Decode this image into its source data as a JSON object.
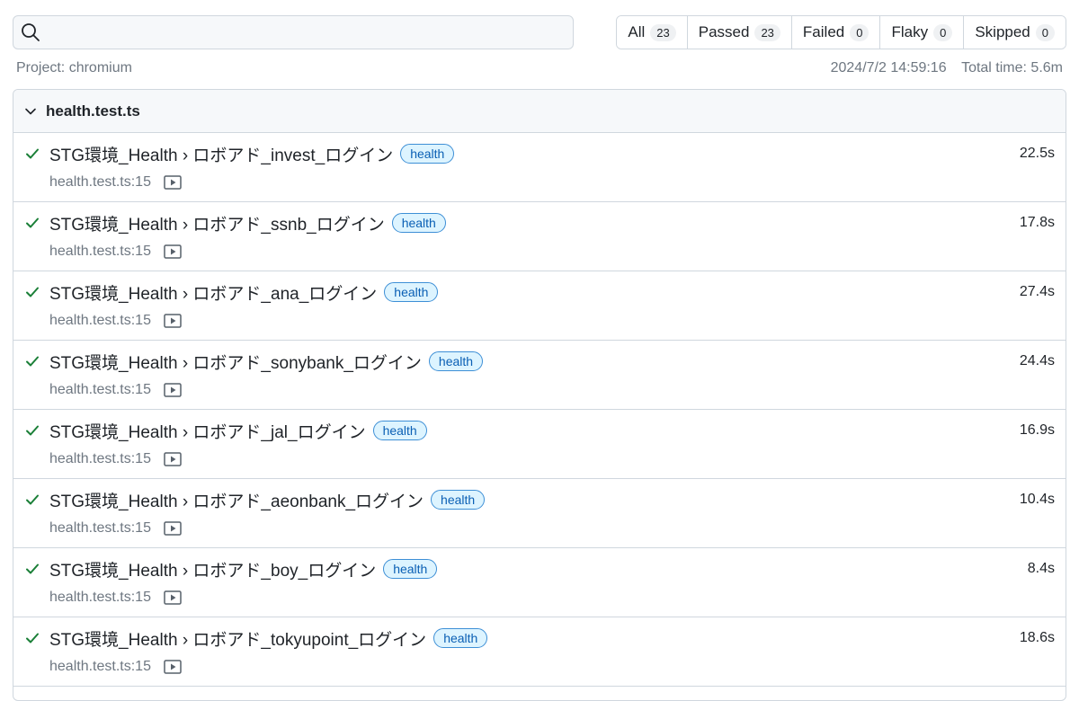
{
  "search": {
    "value": "",
    "placeholder": ""
  },
  "filters": [
    {
      "label": "All",
      "count": "23"
    },
    {
      "label": "Passed",
      "count": "23"
    },
    {
      "label": "Failed",
      "count": "0"
    },
    {
      "label": "Flaky",
      "count": "0"
    },
    {
      "label": "Skipped",
      "count": "0"
    }
  ],
  "meta": {
    "project": "Project: chromium",
    "datetime": "2024/7/2 14:59:16",
    "total_time": "Total time: 5.6m"
  },
  "file": {
    "name": "health.test.ts"
  },
  "tests": [
    {
      "title": "STG環境_Health › ロボアド_invest_ログイン",
      "tag": "health",
      "duration": "22.5s",
      "location": "health.test.ts:15",
      "status": "passed"
    },
    {
      "title": "STG環境_Health › ロボアド_ssnb_ログイン",
      "tag": "health",
      "duration": "17.8s",
      "location": "health.test.ts:15",
      "status": "passed"
    },
    {
      "title": "STG環境_Health › ロボアド_ana_ログイン",
      "tag": "health",
      "duration": "27.4s",
      "location": "health.test.ts:15",
      "status": "passed"
    },
    {
      "title": "STG環境_Health › ロボアド_sonybank_ログイン",
      "tag": "health",
      "duration": "24.4s",
      "location": "health.test.ts:15",
      "status": "passed"
    },
    {
      "title": "STG環境_Health › ロボアド_jal_ログイン",
      "tag": "health",
      "duration": "16.9s",
      "location": "health.test.ts:15",
      "status": "passed"
    },
    {
      "title": "STG環境_Health › ロボアド_aeonbank_ログイン",
      "tag": "health",
      "duration": "10.4s",
      "location": "health.test.ts:15",
      "status": "passed"
    },
    {
      "title": "STG環境_Health › ロボアド_boy_ログイン",
      "tag": "health",
      "duration": "8.4s",
      "location": "health.test.ts:15",
      "status": "passed"
    },
    {
      "title": "STG環境_Health › ロボアド_tokyupoint_ログイン",
      "tag": "health",
      "duration": "18.6s",
      "location": "health.test.ts:15",
      "status": "passed"
    }
  ],
  "colors": {
    "passed": "#1a7f37",
    "tag_text": "#0a5fb4",
    "tag_border": "#3d8fd6",
    "tag_bg": "#ddf4ff"
  },
  "icons": {
    "search": "search-icon",
    "chevron": "chevron-down-icon",
    "check": "check-icon",
    "video": "video-icon"
  }
}
